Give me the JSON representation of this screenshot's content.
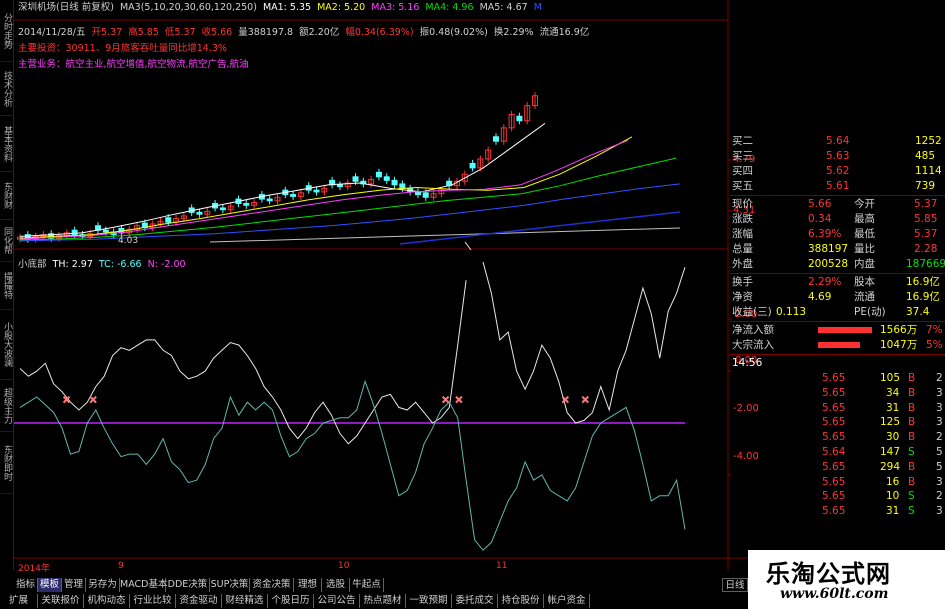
{
  "colors": {
    "background": "#000000",
    "up": "#ff3333",
    "down": "#54ffff",
    "flat": "#c0c0c0",
    "yellow": "#ffff00",
    "grid": "#7a0000",
    "ma1": "#ffffff",
    "ma2": "#ffff00",
    "ma3": "#ff40ff",
    "ma4": "#00e000",
    "ma5": "#3050ff"
  },
  "left_tabs": [
    "分时走势",
    "技术分析",
    "基本资料",
    "东财财",
    "同化帮",
    "撮撮特",
    "小股大波澜",
    "超级主力",
    "东财即时"
  ],
  "header": {
    "stock": "深圳机场(日线 前复权)",
    "ma_params": "MA3(5,10,20,30,60,120,250)",
    "ma1": "MA1: 5.35",
    "ma2": "MA2: 5.20",
    "ma3": "MA3: 5.16",
    "ma4": "MA4: 4.96",
    "ma5": "MA5: 4.67",
    "ma6": "M"
  },
  "bar_info": {
    "date": "2014/11/28/五",
    "open": "开5.37",
    "high": "高5.85",
    "low": "低5.37",
    "close": "收5.66",
    "volume": "量388197.8",
    "amount": "额2.20亿",
    "change": "幅0.34(6.39%)",
    "amplitude": "振0.48(9.02%)",
    "turnover": "换2.29%",
    "float": "流通16.9亿"
  },
  "main_investor": "主要投资：30911、9月旅客吞吐量同比增14.3%",
  "main_business": "主营业务：航空主业,航空增值,航空物流,航空广告,航油",
  "price_axis": {
    "label_top": "4.79",
    "label_mid": "4.31",
    "low_marker": "4.03"
  },
  "chart_data": [
    {
      "type": "line",
      "title": "",
      "xlabel": "",
      "ylabel": "",
      "x_ticks": [
        "2014年",
        "9",
        "10",
        "11"
      ],
      "candles_close": [
        4.07,
        4.05,
        4.08,
        4.1,
        4.06,
        4.09,
        4.12,
        4.1,
        4.08,
        4.11,
        4.15,
        4.13,
        4.1,
        4.12,
        4.16,
        4.2,
        4.18,
        4.22,
        4.25,
        4.24,
        4.28,
        4.31,
        4.35,
        4.33,
        4.36,
        4.4,
        4.38,
        4.42,
        4.45,
        4.43,
        4.46,
        4.5,
        4.48,
        4.52,
        4.55,
        4.53,
        4.57,
        4.6,
        4.58,
        4.62,
        4.66,
        4.64,
        4.68,
        4.7,
        4.67,
        4.72,
        4.75,
        4.71,
        4.66,
        4.62,
        4.58,
        4.55,
        4.52,
        4.56,
        4.6,
        4.65,
        4.7,
        4.78,
        4.85,
        4.95,
        5.05,
        5.15,
        5.3,
        5.45,
        5.38,
        5.55,
        5.66
      ],
      "series": [
        {
          "name": "MA1",
          "values": [
            4.08,
            4.1,
            4.12,
            4.18,
            4.25,
            4.33,
            4.4,
            4.47,
            4.54,
            4.6,
            4.66,
            4.68,
            4.62,
            4.58,
            4.66,
            4.85,
            5.1,
            5.35
          ]
        },
        {
          "name": "MA2",
          "values": [
            4.06,
            4.08,
            4.1,
            4.15,
            4.22,
            4.28,
            4.35,
            4.42,
            4.49,
            4.55,
            4.6,
            4.63,
            4.61,
            4.6,
            4.63,
            4.78,
            4.98,
            5.2
          ]
        },
        {
          "name": "MA3",
          "values": [
            4.05,
            4.07,
            4.09,
            4.13,
            4.19,
            4.25,
            4.31,
            4.37,
            4.43,
            4.49,
            4.54,
            4.58,
            4.6,
            4.61,
            4.66,
            4.82,
            5.0,
            5.16
          ]
        },
        {
          "name": "MA4",
          "values": [
            4.04,
            4.05,
            4.07,
            4.1,
            4.14,
            4.18,
            4.23,
            4.28,
            4.33,
            4.38,
            4.43,
            4.48,
            4.52,
            4.56,
            4.65,
            4.76,
            4.86,
            4.96
          ]
        },
        {
          "name": "MA5",
          "values": [
            4.03,
            4.04,
            4.05,
            4.07,
            4.09,
            4.11,
            4.14,
            4.17,
            4.2,
            4.24,
            4.28,
            4.33,
            4.38,
            4.43,
            4.5,
            4.56,
            4.62,
            4.67
          ]
        }
      ]
    },
    {
      "type": "line",
      "title": "小底部",
      "params": {
        "TH": "TH: 2.97",
        "TC": "TC: -6.66",
        "N": "N: -2.00"
      },
      "y_ticks": [
        "2.00",
        "0.00",
        "-2.00",
        "-4.00"
      ],
      "ylim": [
        -7.2,
        4.2
      ],
      "th_level": -2.0,
      "series": [
        {
          "name": "TH",
          "values": [
            0.1,
            -0.2,
            0.0,
            0.3,
            -0.5,
            -0.8,
            -1.2,
            -1.5,
            -1.2,
            -0.6,
            -0.2,
            0.6,
            0.9,
            0.8,
            1.0,
            1.2,
            1.2,
            0.8,
            0.6,
            0.0,
            -0.3,
            -0.2,
            0.0,
            0.5,
            0.8,
            1.1,
            1.0,
            0.6,
            0.1,
            -0.6,
            -1.0,
            -1.5,
            -2.2,
            -2.6,
            -2.2,
            -1.6,
            -1.2,
            -1.7,
            -2.4,
            -2.8,
            -2.5,
            -2.0,
            -1.5,
            -1.0,
            -0.9,
            -1.4,
            -1.5,
            -1.2,
            -1.6,
            -2.0,
            -1.8,
            -1.4,
            1.0,
            3.5,
            5.6,
            4.2,
            3.0,
            1.2,
            1.5,
            0.0,
            -0.7,
            0.0,
            1.0,
            0.5,
            -0.4,
            -1.6,
            -2.0,
            -1.9,
            -1.6,
            -0.6,
            -1.5,
            0.0,
            0.8,
            2.0,
            3.2,
            2.2,
            0.5,
            2.3,
            3.0,
            4.0
          ]
        },
        {
          "name": "TC",
          "values": [
            -1.4,
            -1.2,
            -1.0,
            -1.3,
            -1.6,
            -2.2,
            -3.2,
            -3.1,
            -2.0,
            -1.5,
            -2.2,
            -2.8,
            -3.3,
            -3.2,
            -3.2,
            -3.6,
            -3.2,
            -2.6,
            -3.5,
            -3.8,
            -4.3,
            -4.2,
            -3.6,
            -2.6,
            -2.2,
            -1.0,
            -1.7,
            -1.2,
            -1.5,
            -1.2,
            -1.5,
            -2.5,
            -3.3,
            -3.1,
            -2.6,
            -2.4,
            -2.0,
            -1.9,
            -1.8,
            -1.8,
            -1.5,
            -0.4,
            -1.3,
            -2.4,
            -3.6,
            -4.8,
            -4.6,
            -3.9,
            -2.8,
            -2.2,
            -1.5,
            -1.2,
            -1.8,
            -4.2,
            -6.5,
            -6.9,
            -6.6,
            -5.8,
            -5.0,
            -4.5,
            -3.5,
            -4.2,
            -4.0,
            -4.6,
            -4.8,
            -5.0,
            -4.5,
            -3.5,
            -2.5,
            -2.0,
            -1.8,
            -1.6,
            -1.4,
            -2.3,
            -3.6,
            -5.0,
            -4.8,
            -4.8,
            -4.2,
            -6.1
          ]
        }
      ],
      "buy_signals_at": [
        0.07,
        0.11,
        0.64,
        0.66,
        0.82,
        0.85
      ]
    }
  ],
  "quote": {
    "rows": [
      {
        "label": "买二",
        "price": "5.64",
        "vol": "1252"
      },
      {
        "label": "买三",
        "price": "5.63",
        "vol": "485"
      },
      {
        "label": "买四",
        "price": "5.62",
        "vol": "1114"
      },
      {
        "label": "买五",
        "price": "5.61",
        "vol": "739"
      }
    ],
    "stats": [
      {
        "l1": "现价",
        "v1": "5.66",
        "l2": "今开",
        "v2": "5.37"
      },
      {
        "l1": "涨跌",
        "v1": "0.34",
        "l2": "最高",
        "v2": "5.85"
      },
      {
        "l1": "涨幅",
        "v1": "6.39%",
        "l2": "最低",
        "v2": "5.37"
      },
      {
        "l1": "总量",
        "v1": "388197",
        "l2": "量比",
        "v2": "2.28"
      },
      {
        "l1": "外盘",
        "v1": "200528",
        "l2": "内盘",
        "v2": "187669"
      },
      {
        "l1": "换手",
        "v1": "2.29%",
        "l2": "股本",
        "v2": "16.9亿"
      },
      {
        "l1": "净资",
        "v1": "4.69",
        "l2": "流通",
        "v2": "16.9亿"
      },
      {
        "l1": "收益(三)",
        "v1": "0.113",
        "l2": "PE(动)",
        "v2": "37.4"
      }
    ],
    "flow": [
      {
        "label": "净流入额",
        "value": "1566万",
        "pct": "7%",
        "fill": 0.9
      },
      {
        "label": "大宗流入",
        "value": "1047万",
        "pct": "5%",
        "fill": 0.7
      }
    ],
    "tick_time": "14:56",
    "ticks": [
      {
        "price": "5.65",
        "vol": "105",
        "side": "B",
        "n": "2"
      },
      {
        "price": "5.65",
        "vol": "34",
        "side": "B",
        "n": "3"
      },
      {
        "price": "5.65",
        "vol": "31",
        "side": "B",
        "n": "3"
      },
      {
        "price": "5.65",
        "vol": "125",
        "side": "B",
        "n": "3"
      },
      {
        "price": "5.65",
        "vol": "30",
        "side": "B",
        "n": "2"
      },
      {
        "price": "5.64",
        "vol": "147",
        "side": "S",
        "n": "5"
      },
      {
        "price": "5.65",
        "vol": "294",
        "side": "B",
        "n": "5"
      },
      {
        "price": "5.65",
        "vol": "16",
        "side": "B",
        "n": "3"
      },
      {
        "price": "5.65",
        "vol": "10",
        "side": "S",
        "n": "2"
      },
      {
        "price": "5.65",
        "vol": "31",
        "side": "S",
        "n": "3"
      }
    ]
  },
  "bottom_tabs_1": [
    "指标",
    "模板",
    "管理",
    "另存为",
    "MACD基本",
    "DDE决策",
    "SUP决策",
    "资金决策",
    "理想",
    "选股",
    "牛起点"
  ],
  "bottom_tabs_2": [
    "扩展",
    "关联报价",
    "机构动态",
    "行业比较",
    "资金驱动",
    "财经精选",
    "个股日历",
    "公司公告",
    "热点题材",
    "一致预期",
    "委托成交",
    "持仓股份",
    "帐户资金"
  ],
  "period_label": "日线",
  "watermark": {
    "title": "乐淘公式网",
    "url": "www.60lt.com"
  }
}
